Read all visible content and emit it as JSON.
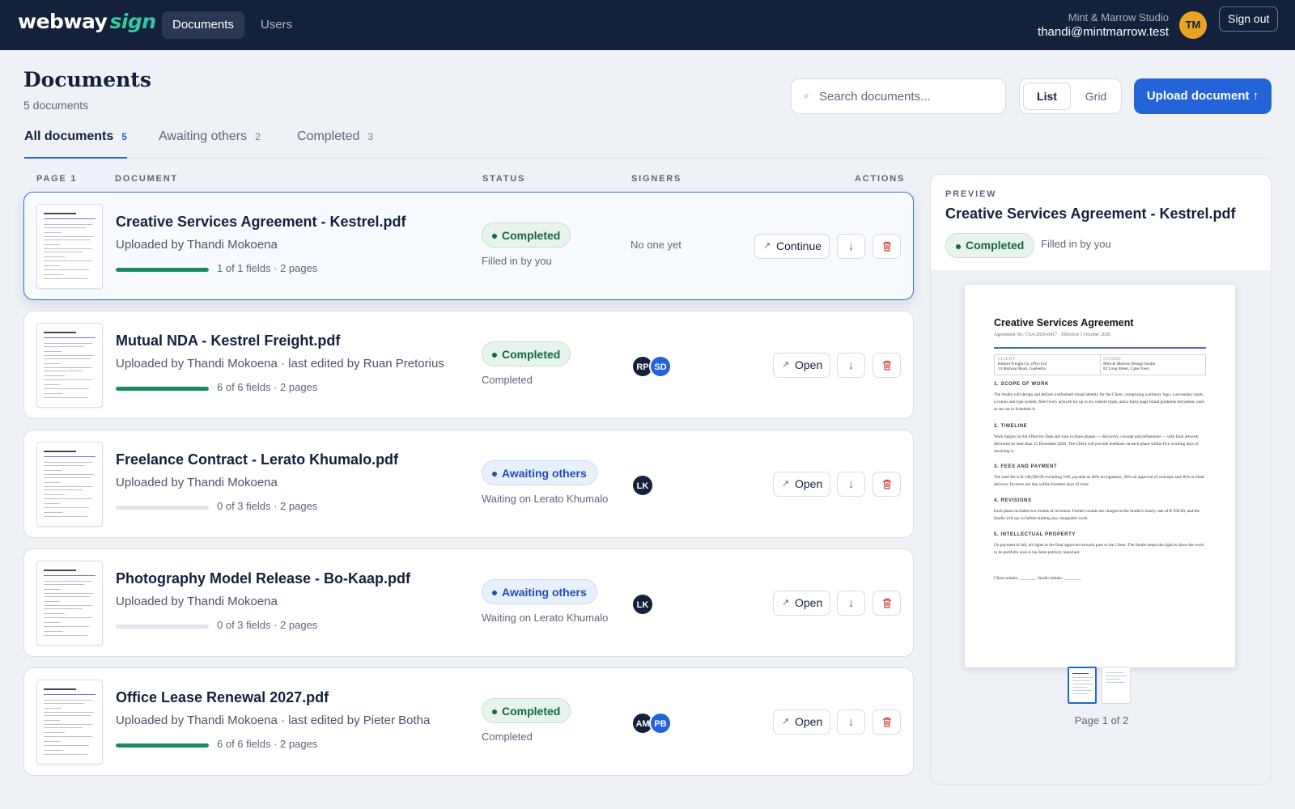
{
  "app": {
    "brand_main": "webway",
    "brand_accent": "sign",
    "nav": [
      {
        "label": "Documents"
      },
      {
        "label": "Users"
      }
    ],
    "org": "Mint & Marrow Studio",
    "email": "thandi@mintmarrow.test",
    "avatar_initials": "TM",
    "sign_out": "Sign out"
  },
  "header": {
    "title": "Documents",
    "count": "5 documents",
    "search_placeholder": "Search documents...",
    "view_list": "List",
    "view_grid": "Grid",
    "upload": "Upload document ↑"
  },
  "tabs": [
    {
      "label": "All documents",
      "count": "5"
    },
    {
      "label": "Awaiting others",
      "count": "2"
    },
    {
      "label": "Completed",
      "count": "3"
    }
  ],
  "columns": {
    "page": "PAGE 1",
    "document": "DOCUMENT",
    "status": "STATUS",
    "signers": "SIGNERS",
    "actions": "ACTIONS"
  },
  "documents": [
    {
      "name": "Creative Services Agreement - Kestrel.pdf",
      "sub": "Uploaded by Thandi Mokoena",
      "progress": 1.0,
      "fields": "1 of 1 fields · 2 pages",
      "status": "Completed",
      "status_note": "Filled in by you",
      "signers_text": "No one yet",
      "signers": [],
      "action": "Continue"
    },
    {
      "name": "Mutual NDA - Kestrel Freight.pdf",
      "sub": "Uploaded by Thandi Mokoena · last edited by Ruan Pretorius",
      "progress": 1.0,
      "fields": "6 of 6 fields · 2 pages",
      "status": "Completed",
      "status_note": "Completed",
      "signers_text": "",
      "signers": [
        {
          "initials": "RP",
          "color": "#13213b"
        },
        {
          "initials": "SD",
          "color": "#2563d9"
        }
      ],
      "action": "Open"
    },
    {
      "name": "Freelance Contract - Lerato Khumalo.pdf",
      "sub": "Uploaded by Thandi Mokoena",
      "progress": 0.0,
      "fields": "0 of 3 fields · 2 pages",
      "status": "Awaiting others",
      "status_note": "Waiting on Lerato Khumalo",
      "signers_text": "",
      "signers": [
        {
          "initials": "LK",
          "color": "#13213b"
        }
      ],
      "action": "Open"
    },
    {
      "name": "Photography Model Release - Bo-Kaap.pdf",
      "sub": "Uploaded by Thandi Mokoena",
      "progress": 0.0,
      "fields": "0 of 3 fields · 2 pages",
      "status": "Awaiting others",
      "status_note": "Waiting on Lerato Khumalo",
      "signers_text": "",
      "signers": [
        {
          "initials": "LK",
          "color": "#13213b"
        }
      ],
      "action": "Open"
    },
    {
      "name": "Office Lease Renewal 2027.pdf",
      "sub": "Uploaded by Thandi Mokoena · last edited by Pieter Botha",
      "progress": 1.0,
      "fields": "6 of 6 fields · 2 pages",
      "status": "Completed",
      "status_note": "Completed",
      "signers_text": "",
      "signers": [
        {
          "initials": "AM",
          "color": "#13213b"
        },
        {
          "initials": "PB",
          "color": "#2563d9"
        }
      ],
      "action": "Open"
    }
  ],
  "preview": {
    "label": "PREVIEW",
    "title": "Creative Services Agreement - Kestrel.pdf",
    "status": "Completed",
    "note": "Filled in by you",
    "page_label": "Page 1 of 2",
    "doc": {
      "title": "Creative Services Agreement",
      "meta": "Agreement No. CSA-2026-0417 · Effective 1 October 2026",
      "client_label": "CLIENT",
      "client_1": "Kestrel Freight Co. (Pty) Ltd",
      "client_2": "14 Harbour Road, Gqeberha",
      "studio_label": "STUDIO",
      "studio_1": "Mint & Marrow Design Studio",
      "studio_2": "82 Long Street, Cape Town",
      "h1": "1. SCOPE OF WORK",
      "p1": "The Studio will design and deliver a refreshed visual identity for the Client, comprising a primary logo, a secondary mark, a colour and type system, fleet livery artwork for up to six vehicle types, and a thirty-page brand guideline document, each as set out in Schedule A.",
      "h2": "2. TIMELINE",
      "p2": "Work begins on the Effective Date and runs in three phases — discovery, concept and refinement — with final artwork delivered no later than 15 December 2026. The Client will provide feedback on each phase within five working days of receiving it.",
      "h3": "3. FEES AND PAYMENT",
      "p3": "The total fee is R 148,500.00 excluding VAT, payable as 40% on signature, 30% on approval of concepts and 30% on final delivery. Invoices are due within fourteen days of issue.",
      "h4": "4. REVISIONS",
      "p4": "Each phase includes two rounds of revisions. Further rounds are charged at the Studio's hourly rate of R 950.00, and the Studio will say so before starting any chargeable work.",
      "h5": "5. INTELLECTUAL PROPERTY",
      "p5": "On payment in full, all rights in the final approved artwork pass to the Client. The Studio keeps the right to show the work in its portfolio once it has been publicly launched.",
      "initials": "Client initials: ________     Studio initials: ________"
    }
  },
  "colors": {
    "navy": "#13213b",
    "accent_blue": "#2563d9",
    "brand_green": "#35c8a7",
    "completed_green": "#14673f",
    "awaiting_blue": "#1f4fb0",
    "delete_red": "#d63a3a"
  },
  "icons": {
    "search": "search-icon",
    "open": "external-link-icon",
    "download": "download-icon",
    "delete": "trash-icon"
  }
}
